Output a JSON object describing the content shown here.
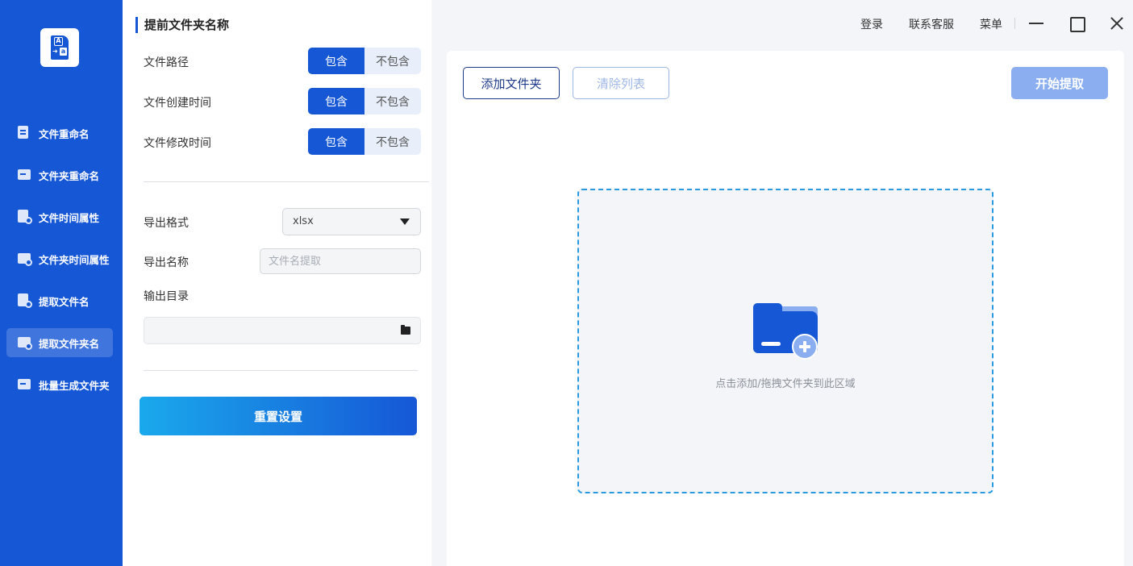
{
  "sidebar": {
    "items": [
      {
        "label": "文件重命名"
      },
      {
        "label": "文件夹重命名"
      },
      {
        "label": "文件时间属性"
      },
      {
        "label": "文件夹时间属性"
      },
      {
        "label": "提取文件名"
      },
      {
        "label": "提取文件夹名",
        "active": true
      },
      {
        "label": "批量生成文件夹"
      }
    ]
  },
  "panel": {
    "title": "提前文件夹名称",
    "options": [
      {
        "label": "文件路径",
        "on": "包含",
        "off": "不包含",
        "selected": "包含"
      },
      {
        "label": "文件创建时间",
        "on": "包含",
        "off": "不包含",
        "selected": "包含"
      },
      {
        "label": "文件修改时间",
        "on": "包含",
        "off": "不包含",
        "selected": "包含"
      }
    ],
    "export_format_label": "导出格式",
    "export_format_value": "xlsx",
    "export_name_label": "导出名称",
    "export_name_placeholder": "文件名提取",
    "output_dir_label": "输出目录",
    "reset_label": "重置设置"
  },
  "topbar": {
    "login": "登录",
    "support": "联系客服",
    "menu": "菜单"
  },
  "main": {
    "add_folder": "添加文件夹",
    "clear_list": "清除列表",
    "start": "开始提取",
    "drop_hint": "点击添加/拖拽文件夹到此区域"
  },
  "colors": {
    "accent": "#1657d6",
    "dropzone_border": "#2a9ae0",
    "start_disabled": "#8aaef0"
  }
}
